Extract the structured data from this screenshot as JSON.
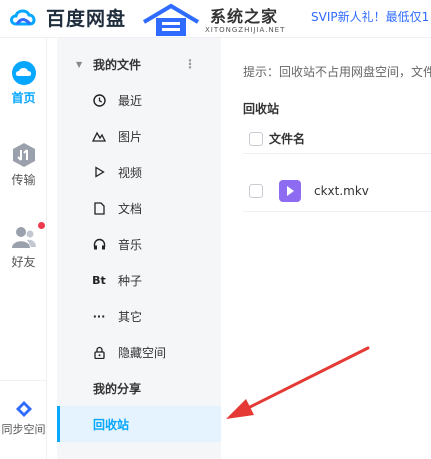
{
  "header": {
    "app_name": "百度网盘",
    "watermark_title": "系统之家",
    "watermark_sub": "XITONGZHIJIA.NET",
    "promo": "SVIP新人礼！最低仅1"
  },
  "rail": {
    "items": [
      {
        "label": "首页",
        "icon": "cloud-icon",
        "active": true
      },
      {
        "label": "传输",
        "icon": "transfer-icon",
        "active": false
      },
      {
        "label": "好友",
        "icon": "friends-icon",
        "active": false,
        "badge": true
      },
      {
        "label": "同步空间",
        "icon": "sync-icon",
        "active": false
      }
    ]
  },
  "menu": {
    "my_files": "我的文件",
    "more": "⋮",
    "items": [
      {
        "label": "最近",
        "icon": "clock-icon"
      },
      {
        "label": "图片",
        "icon": "image-icon"
      },
      {
        "label": "视频",
        "icon": "play-icon"
      },
      {
        "label": "文档",
        "icon": "document-icon"
      },
      {
        "label": "音乐",
        "icon": "headphones-icon"
      },
      {
        "label": "种子",
        "icon": "bt-icon",
        "glyph": "Bt"
      },
      {
        "label": "其它",
        "icon": "more-icon",
        "glyph": "···"
      },
      {
        "label": "隐藏空间",
        "icon": "lock-icon"
      }
    ],
    "my_share": "我的分享",
    "recycle_bin": "回收站"
  },
  "main": {
    "tip": "提示：回收站不占用网盘空间，文件",
    "breadcrumb": "回收站",
    "col_filename": "文件名",
    "files": [
      {
        "name": "ckxt.mkv",
        "type": "video"
      }
    ]
  },
  "colors": {
    "accent": "#06a7ff",
    "promo": "#2f6bff",
    "arrow": "#e53935",
    "video_icon": "#8d6cf2",
    "badge": "#f0394d"
  }
}
